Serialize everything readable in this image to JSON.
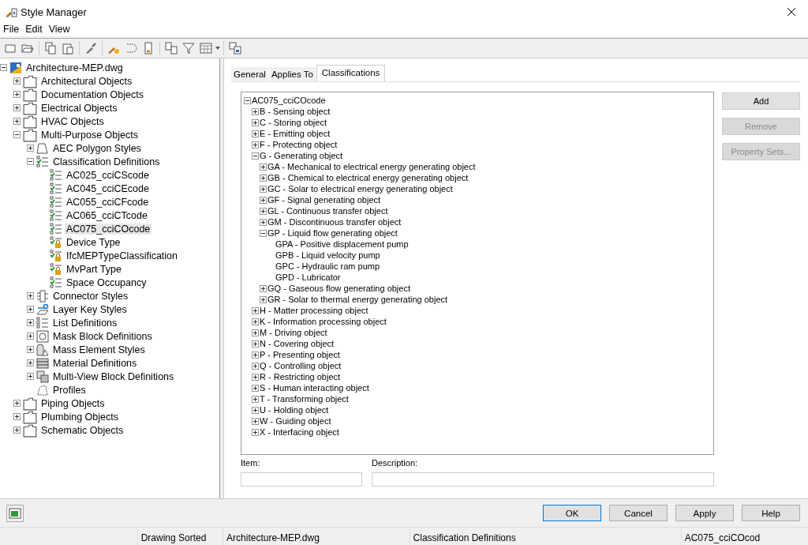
{
  "window": {
    "title": "Style Manager"
  },
  "menu": [
    "File",
    "Edit",
    "View"
  ],
  "tree": [
    {
      "label": "Architecture-MEP.dwg",
      "kind": "drawing",
      "expanded": true,
      "selected": false,
      "children": [
        {
          "label": "Architectural Objects",
          "kind": "folder",
          "expanded": false,
          "selected": false
        },
        {
          "label": "Documentation Objects",
          "kind": "folder",
          "expanded": false,
          "selected": false
        },
        {
          "label": "Electrical Objects",
          "kind": "folder",
          "expanded": false,
          "selected": false
        },
        {
          "label": "HVAC Objects",
          "kind": "folder",
          "expanded": false,
          "selected": false
        },
        {
          "label": "Multi-Purpose Objects",
          "kind": "folder",
          "expanded": true,
          "selected": false,
          "children": [
            {
              "label": "AEC Polygon Styles",
              "kind": "polygon",
              "expanded": false,
              "selected": false
            },
            {
              "label": "Classification Definitions",
              "kind": "classification",
              "expanded": true,
              "selected": false,
              "children": [
                {
                  "label": "AC025_cciCScode",
                  "kind": "classification",
                  "selected": false
                },
                {
                  "label": "AC045_cciCEcode",
                  "kind": "classification",
                  "selected": false
                },
                {
                  "label": "AC055_cciCFcode",
                  "kind": "classification",
                  "selected": false
                },
                {
                  "label": "AC065_cciCTcode",
                  "kind": "classification",
                  "selected": false
                },
                {
                  "label": "AC075_cciCOcode",
                  "kind": "classification",
                  "selected": true
                },
                {
                  "label": "Device Type",
                  "kind": "locked",
                  "selected": false
                },
                {
                  "label": "IfcMEPTypeClassification",
                  "kind": "locked",
                  "selected": false
                },
                {
                  "label": "MvPart Type",
                  "kind": "locked",
                  "selected": false
                },
                {
                  "label": "Space Occupancy",
                  "kind": "classification",
                  "selected": false
                }
              ]
            },
            {
              "label": "Connector Styles",
              "kind": "connector",
              "expanded": false,
              "selected": false
            },
            {
              "label": "Layer Key Styles",
              "kind": "layerkey",
              "expanded": false,
              "selected": false
            },
            {
              "label": "List Definitions",
              "kind": "list",
              "expanded": false,
              "selected": false
            },
            {
              "label": "Mask Block Definitions",
              "kind": "mask",
              "expanded": false,
              "selected": false
            },
            {
              "label": "Mass Element Styles",
              "kind": "mass",
              "expanded": false,
              "selected": false
            },
            {
              "label": "Material Definitions",
              "kind": "material",
              "expanded": false,
              "selected": false
            },
            {
              "label": "Multi-View Block Definitions",
              "kind": "multiview",
              "expanded": false,
              "selected": false
            },
            {
              "label": "Profiles",
              "kind": "profile",
              "selected": false
            }
          ]
        },
        {
          "label": "Piping Objects",
          "kind": "folder",
          "expanded": false,
          "selected": false
        },
        {
          "label": "Plumbing Objects",
          "kind": "folder",
          "expanded": false,
          "selected": false
        },
        {
          "label": "Schematic Objects",
          "kind": "folder",
          "expanded": false,
          "selected": false
        }
      ]
    }
  ],
  "tabs": [
    {
      "label": "General",
      "selected": false
    },
    {
      "label": "Applies To",
      "selected": false
    },
    {
      "label": "Classifications",
      "selected": true
    }
  ],
  "classifications": [
    {
      "label": "AC075_cciCOcode",
      "expanded": true,
      "children": [
        {
          "label": "B - Sensing object",
          "expanded": false
        },
        {
          "label": "C - Storing object",
          "expanded": false
        },
        {
          "label": "E - Emitting object",
          "expanded": false
        },
        {
          "label": "F - Protecting object",
          "expanded": false
        },
        {
          "label": "G - Generating object",
          "expanded": true,
          "children": [
            {
              "label": "GA - Mechanical to electrical energy generating object",
              "expanded": false
            },
            {
              "label": "GB - Chemical to electrical energy generating object",
              "expanded": false
            },
            {
              "label": "GC - Solar to electrical energy generating object",
              "expanded": false
            },
            {
              "label": "GF - Signal generating object",
              "expanded": false
            },
            {
              "label": "GL - Continuous transfer object",
              "expanded": false
            },
            {
              "label": "GM - Discontinuous transfer object",
              "expanded": false
            },
            {
              "label": "GP - Liquid flow generating object",
              "expanded": true,
              "children": [
                {
                  "label": "GPA - Positive displacement pump"
                },
                {
                  "label": "GPB - Liquid velocity pump"
                },
                {
                  "label": "GPC - Hydraulic ram pump"
                },
                {
                  "label": "GPD - Lubricator"
                }
              ]
            },
            {
              "label": "GQ - Gaseous flow generating object",
              "expanded": false
            },
            {
              "label": "GR - Solar to thermal energy generating object",
              "expanded": false
            }
          ]
        },
        {
          "label": "H - Matter processing object",
          "expanded": false
        },
        {
          "label": "K - Information processing object",
          "expanded": false
        },
        {
          "label": "M - Driving object",
          "expanded": false
        },
        {
          "label": "N - Covering object",
          "expanded": false
        },
        {
          "label": "P - Presenting object",
          "expanded": false
        },
        {
          "label": "Q - Controlling object",
          "expanded": false
        },
        {
          "label": "R - Restricting object",
          "expanded": false
        },
        {
          "label": "S - Human interacting object",
          "expanded": false
        },
        {
          "label": "T - Transforming object",
          "expanded": false
        },
        {
          "label": "U - Holding object",
          "expanded": false
        },
        {
          "label": "W - Guiding object",
          "expanded": false
        },
        {
          "label": "X - Interfacing object",
          "expanded": false
        }
      ]
    }
  ],
  "side_buttons": [
    {
      "label": "Add",
      "disabled": false
    },
    {
      "label": "Remove",
      "disabled": true
    },
    {
      "label": "Property Sets...",
      "disabled": true
    }
  ],
  "fields": [
    {
      "label": "Item:"
    },
    {
      "label": "Description:"
    }
  ],
  "dialog_buttons": [
    {
      "label": "OK",
      "default": true
    },
    {
      "label": "Cancel",
      "default": false
    },
    {
      "label": "Apply",
      "default": false
    },
    {
      "label": "Help",
      "default": false
    }
  ],
  "status_bar": [
    "Drawing Sorted",
    "Architecture-MEP.dwg",
    "Classification Definitions",
    "AC075_cciCOcod"
  ]
}
